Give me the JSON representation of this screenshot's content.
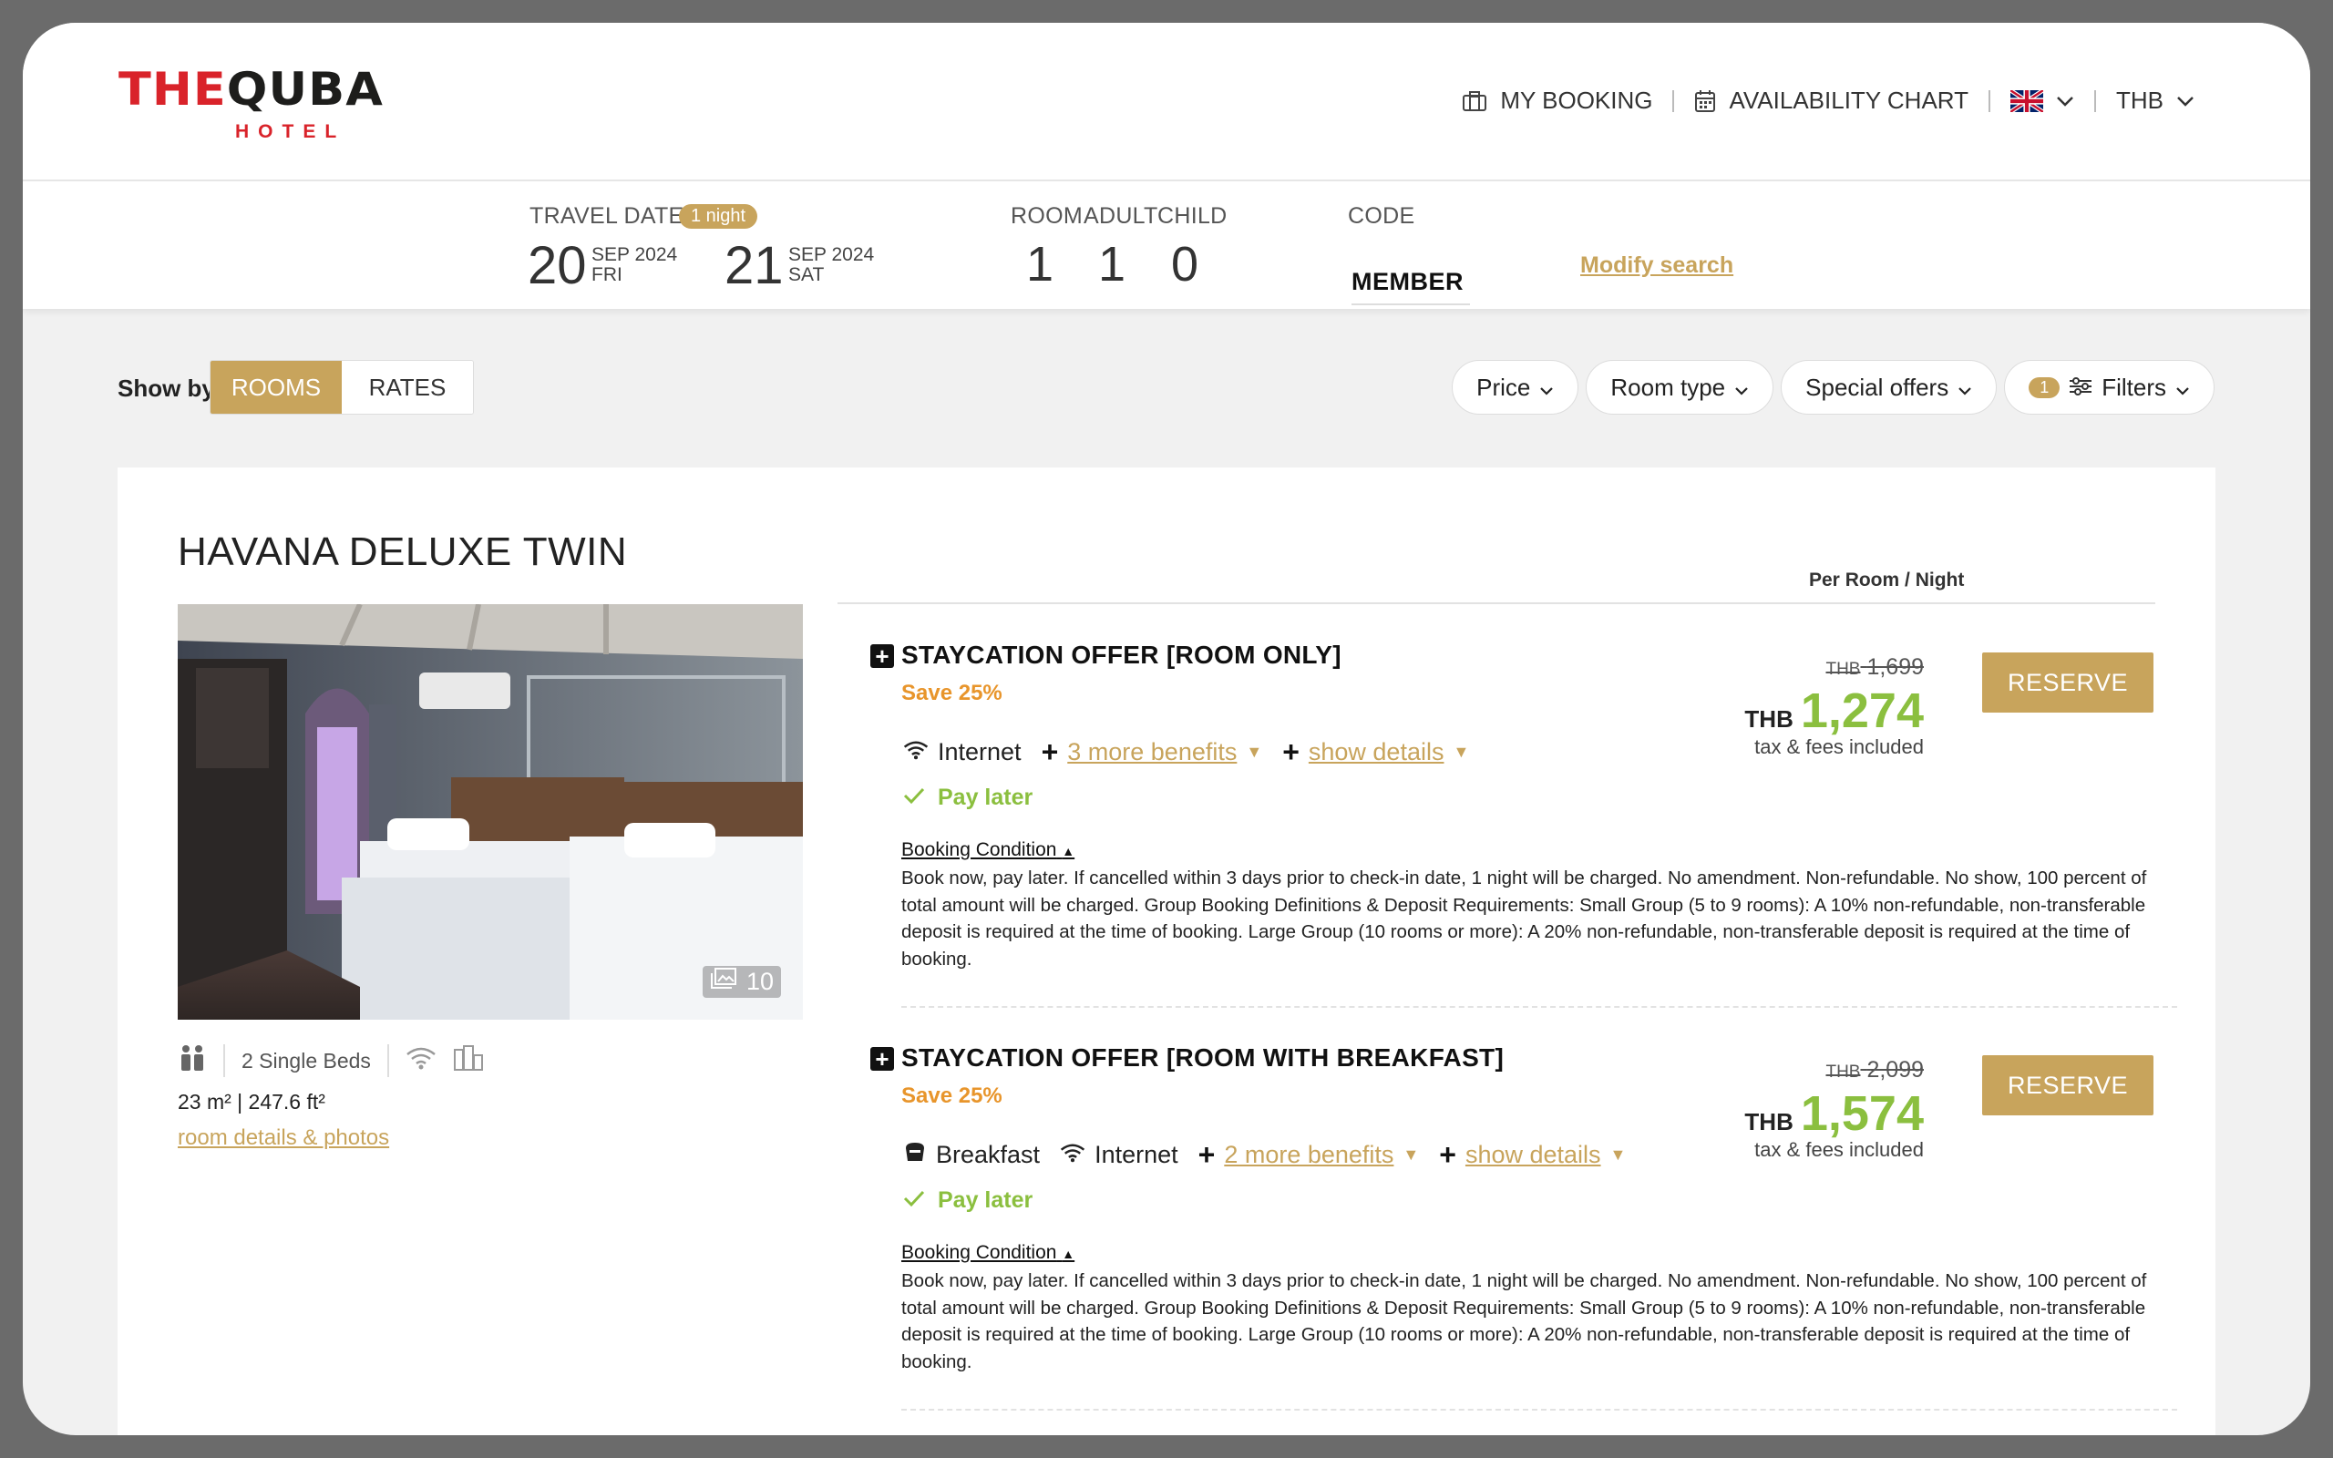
{
  "header": {
    "logo_the": "THE",
    "logo_quba": "QUBA",
    "logo_sub": "HOTEL",
    "my_booking": "MY BOOKING",
    "availability_chart": "AVAILABILITY CHART",
    "language": "English (UK)",
    "currency": "THB"
  },
  "search": {
    "travel_date_label": "TRAVEL DATE",
    "nights_badge": "1 night",
    "checkin_day": "20",
    "checkin_month": "SEP 2024",
    "checkin_weekday": "FRI",
    "checkout_day": "21",
    "checkout_month": "SEP 2024",
    "checkout_weekday": "SAT",
    "room_label": "ROOM",
    "adult_label": "ADULT",
    "child_label": "CHILD",
    "room_value": "1",
    "adult_value": "1",
    "child_value": "0",
    "code_label": "CODE",
    "code_value": "MEMBER",
    "modify": "Modify search"
  },
  "toolbar": {
    "show_by": "Show by",
    "rooms": "ROOMS",
    "rates": "RATES",
    "price": "Price",
    "room_type": "Room type",
    "special_offers": "Special offers",
    "filters_count": "1",
    "filters": "Filters"
  },
  "room": {
    "title": "HAVANA DELUXE TWIN",
    "photo_count": "10",
    "beds": "2 Single Beds",
    "size": "23 m² | 247.6 ft²",
    "details_link": "room details & photos",
    "per_room_night": "Per Room / Night"
  },
  "rates": [
    {
      "title": "STAYCATION OFFER [ROOM ONLY]",
      "save": "Save 25%",
      "benefit_internet": "Internet",
      "more_benefits": "3 more benefits",
      "show_details": "show details",
      "pay_later": "Pay later",
      "booking_condition": "Booking Condition",
      "condition_text": "Book now, pay later. If cancelled within 3 days prior to check-in date, 1 night will be charged. No amendment. Non-refundable. No show, 100 percent of total amount will be charged. Group Booking Definitions & Deposit Requirements: Small Group (5 to 9 rooms): A 10% non-refundable, non-transferable deposit is required at the time of booking. Large Group (10 rooms or more): A 20% non-refundable, non-transferable deposit is required at the time of booking.",
      "old_currency": "THB",
      "old_price": "1,699",
      "currency": "THB",
      "price": "1,274",
      "tax_note": "tax & fees included",
      "reserve": "RESERVE"
    },
    {
      "title": "STAYCATION OFFER [ROOM WITH BREAKFAST]",
      "save": "Save 25%",
      "benefit_breakfast": "Breakfast",
      "benefit_internet": "Internet",
      "more_benefits": "2 more benefits",
      "show_details": "show details",
      "pay_later": "Pay later",
      "booking_condition": "Booking Condition",
      "condition_text": "Book now, pay later. If cancelled within 3 days prior to check-in date, 1 night will be charged. No amendment. Non-refundable. No show, 100 percent of total amount will be charged. Group Booking Definitions & Deposit Requirements: Small Group (5 to 9 rooms): A 10% non-refundable, non-transferable deposit is required at the time of booking. Large Group (10 rooms or more): A 20% non-refundable, non-transferable deposit is required at the time of booking.",
      "old_currency": "THB",
      "old_price": "2,099",
      "currency": "THB",
      "price": "1,574",
      "tax_note": "tax & fees included",
      "reserve": "RESERVE"
    }
  ]
}
